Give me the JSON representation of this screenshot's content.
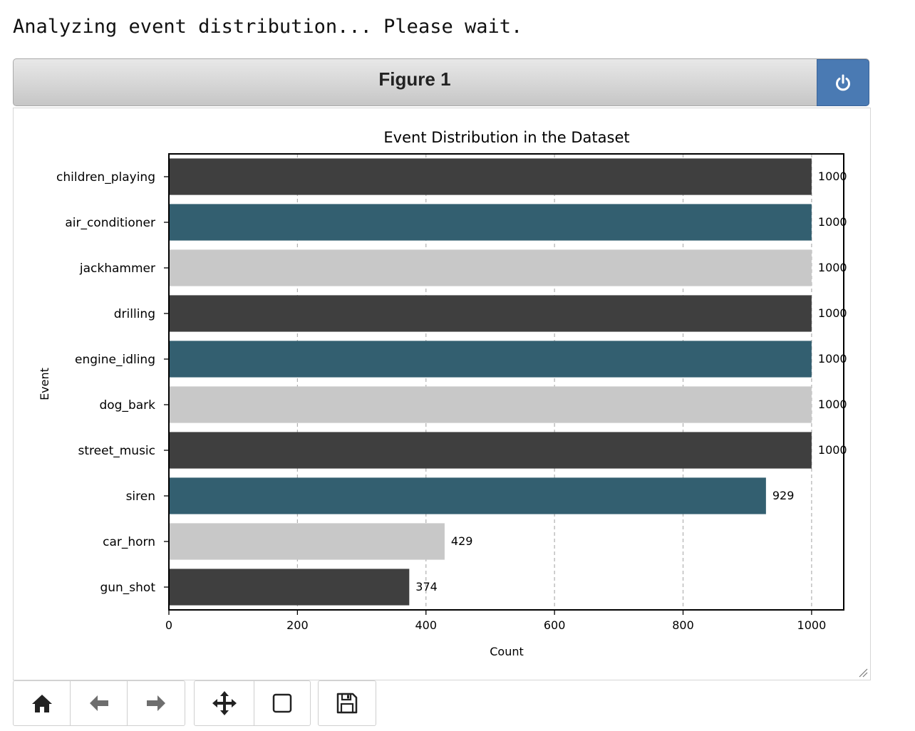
{
  "status_text": "Analyzing event distribution... Please wait.",
  "window": {
    "title": "Figure 1"
  },
  "icons": {
    "power": "power-icon",
    "home": "home-icon",
    "back": "back-arrow-icon",
    "forward": "forward-arrow-icon",
    "pan": "move-arrows-icon",
    "zoom": "zoom-rect-icon",
    "save": "floppy-disk-icon"
  },
  "colors": {
    "accent": "#4a7ab3",
    "dark": "#3f3f3f",
    "teal": "#335f70",
    "light": "#c8c8c8"
  },
  "chart_data": {
    "type": "bar",
    "orientation": "horizontal",
    "title": "Event Distribution in the Dataset",
    "xlabel": "Count",
    "ylabel": "Event",
    "xlim": [
      0,
      1050
    ],
    "xticks": [
      0,
      200,
      400,
      600,
      800,
      1000
    ],
    "grid": "x dashed",
    "categories": [
      "children_playing",
      "air_conditioner",
      "jackhammer",
      "drilling",
      "engine_idling",
      "dog_bark",
      "street_music",
      "siren",
      "car_horn",
      "gun_shot"
    ],
    "values": [
      1000,
      1000,
      1000,
      1000,
      1000,
      1000,
      1000,
      929,
      429,
      374
    ],
    "bar_colors": [
      "#3f3f3f",
      "#335f70",
      "#c8c8c8",
      "#3f3f3f",
      "#335f70",
      "#c8c8c8",
      "#3f3f3f",
      "#335f70",
      "#c8c8c8",
      "#3f3f3f"
    ]
  }
}
